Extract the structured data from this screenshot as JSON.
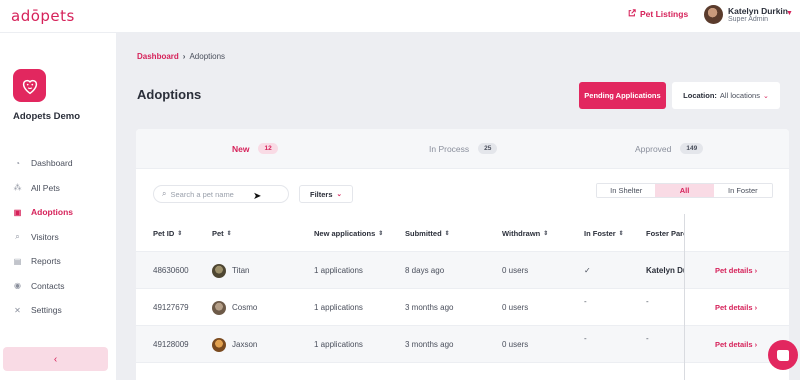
{
  "topbar": {
    "logo": "adōpets",
    "pet_listings": "Pet Listings",
    "user_name": "Katelyn Durkin",
    "user_role": "Super Admin"
  },
  "sidebar": {
    "brand_name": "Adopets Demo",
    "items": [
      {
        "label": "Dashboard",
        "icon": "dashboard-icon"
      },
      {
        "label": "All Pets",
        "icon": "paw-icon"
      },
      {
        "label": "Adoptions",
        "icon": "adoptions-icon",
        "active": true
      },
      {
        "label": "Visitors",
        "icon": "search-icon"
      },
      {
        "label": "Reports",
        "icon": "document-icon"
      },
      {
        "label": "Contacts",
        "icon": "person-icon"
      },
      {
        "label": "Settings",
        "icon": "tools-icon"
      }
    ],
    "collapse_label": "‹"
  },
  "breadcrumb": {
    "root": "Dashboard",
    "sep": "›",
    "current": "Adoptions"
  },
  "page_title": "Adoptions",
  "actions": {
    "pending": "Pending Applications",
    "location_label": "Location:",
    "location_value": "All locations"
  },
  "tabs": [
    {
      "label": "New",
      "count": "12",
      "active": true
    },
    {
      "label": "In Process",
      "count": "25"
    },
    {
      "label": "Approved",
      "count": "149"
    }
  ],
  "search": {
    "placeholder": "Search a pet name"
  },
  "filters_label": "Filters",
  "segments": [
    "In Shelter",
    "All",
    "In Foster"
  ],
  "table": {
    "headers": [
      "Pet ID",
      "Pet",
      "New applications",
      "Submitted",
      "Withdrawn",
      "In Foster",
      "Foster Pare"
    ],
    "rows": [
      {
        "pet_id": "48630600",
        "pet": "Titan",
        "apps": "1 applications",
        "submitted": "8 days ago",
        "withdrawn": "0 users",
        "in_foster": "✓",
        "foster_parent": "Katelyn Dur",
        "link": "Pet details ›"
      },
      {
        "pet_id": "49127679",
        "pet": "Cosmo",
        "apps": "1 applications",
        "submitted": "3 months ago",
        "withdrawn": "0 users",
        "in_foster": "-",
        "foster_parent": "-",
        "link": "Pet details ›"
      },
      {
        "pet_id": "49128009",
        "pet": "Jaxson",
        "apps": "1 applications",
        "submitted": "3 months ago",
        "withdrawn": "0 users",
        "in_foster": "-",
        "foster_parent": "-",
        "link": "Pet details ›"
      }
    ]
  },
  "colors": {
    "accent": "#e2275f",
    "accent_light": "#f9dbe5",
    "background": "#edeef2"
  }
}
